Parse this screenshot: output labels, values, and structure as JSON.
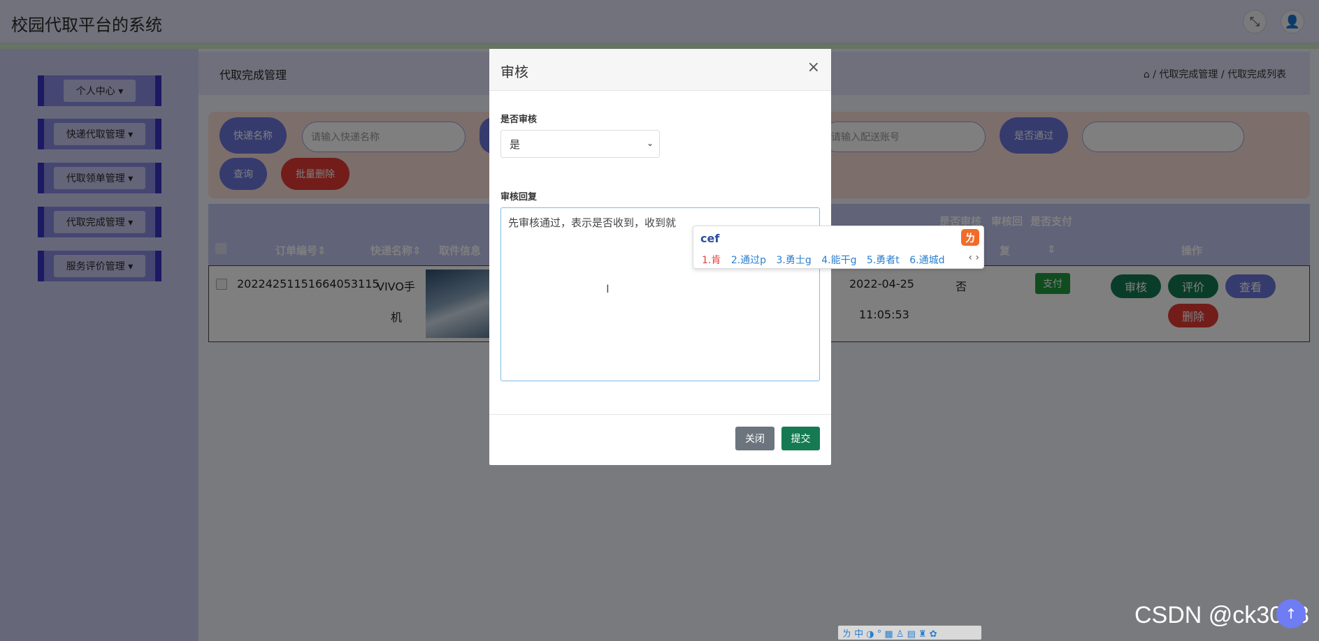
{
  "app": {
    "title": "校园代取平台的系统"
  },
  "topbar": {
    "fullscreen_icon": "⤡",
    "user_icon": "👤"
  },
  "sidebar": {
    "items": [
      {
        "label": "个人中心 ▾"
      },
      {
        "label": "快递代取管理 ▾"
      },
      {
        "label": "代取领单管理 ▾"
      },
      {
        "label": "代取完成管理 ▾"
      },
      {
        "label": "服务评价管理 ▾"
      }
    ]
  },
  "page": {
    "title": "代取完成管理",
    "breadcrumb": "⌂ / 代取完成管理 / 代取完成列表"
  },
  "search": {
    "name_label": "快递名称",
    "name_placeholder": "请输入快递名称",
    "account_placeholder": "请输入配送账号",
    "pass_label": "是否通过",
    "query_button": "查询",
    "batch_delete_button": "批量删除"
  },
  "table": {
    "headers": [
      "订单编号⇕",
      "快递名称⇕",
      "取件信息",
      "是否审核",
      "审核回",
      "是否支付",
      "复",
      "⇕",
      "操作"
    ],
    "rows": [
      {
        "order_no": "20224251151664053115",
        "express_name_line1": "VIVO手",
        "express_name_line2": "机",
        "date_line1": "2022-04-25",
        "date_line2": "11:05:53",
        "reviewed": "否",
        "pay_button": "支付",
        "review_button": "审核",
        "comment_button": "评价",
        "view_button": "查看",
        "delete_button": "删除"
      }
    ]
  },
  "modal": {
    "title": "审核",
    "close_symbol": "×",
    "field_review_label": "是否审核",
    "field_review_value": "是",
    "field_reply_label": "审核回复",
    "field_reply_value": "先审核通过，表示是否收到，收到就",
    "close_button": "关闭",
    "submit_button": "提交"
  },
  "ime": {
    "composition": "cef",
    "logo": "ㄌ",
    "candidates": [
      "1.肯",
      "2.通过p",
      "3.勇士g",
      "4.能干g",
      "5.勇者t",
      "6.通城d"
    ],
    "arrows": "‹ ›",
    "statusbar": "ㄌ 中 ◑ ° ▦ ♙ ▤ ♜ ✿"
  },
  "watermark": "CSDN @ck3018",
  "float_button": "↑",
  "colors": {
    "primary": "#6d77dc",
    "green": "#157a52",
    "red": "#e53b34",
    "sidebar_accent": "#3b34c7"
  }
}
